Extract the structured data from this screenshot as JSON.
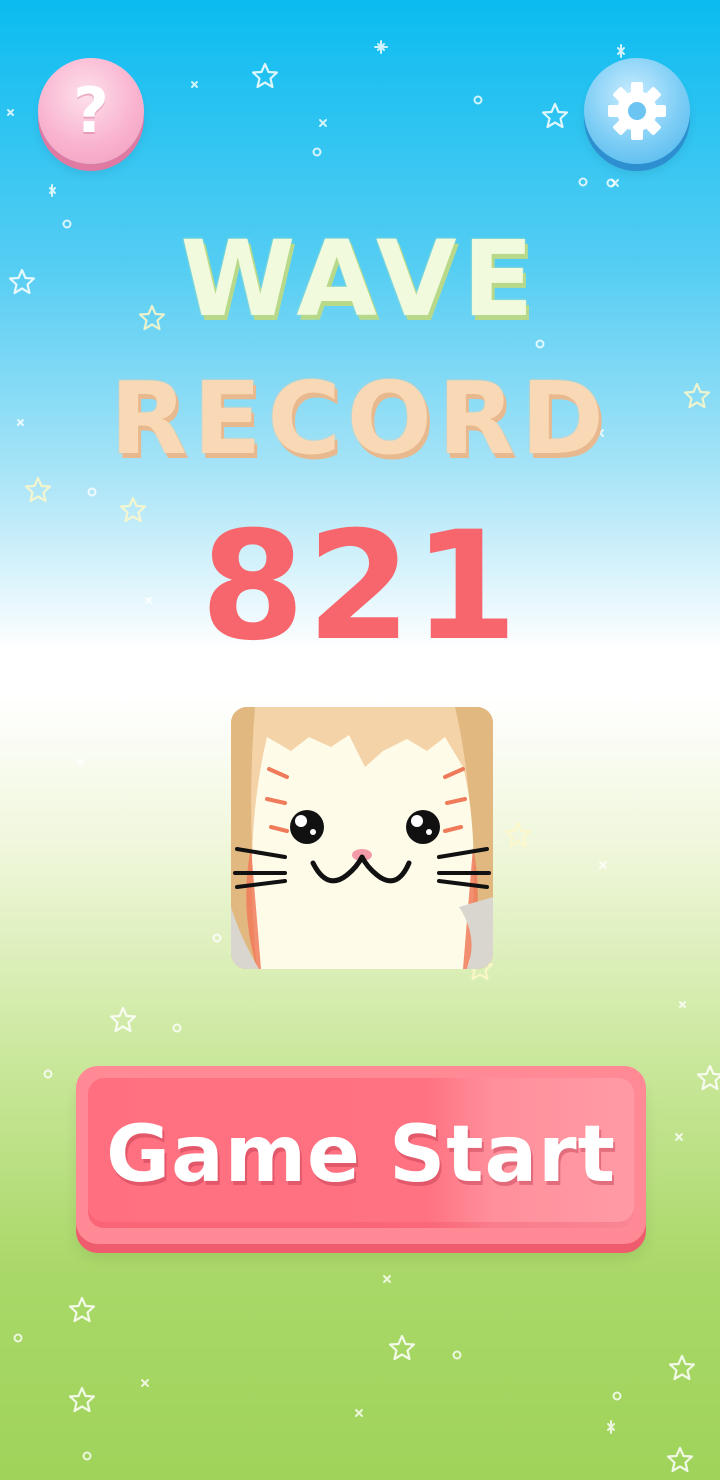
{
  "header": {
    "help_button": {
      "glyph": "?",
      "icon": "question-mark-icon"
    },
    "settings_button": {
      "icon": "gear-icon"
    }
  },
  "title": {
    "line1": "WAVE",
    "line2": "RECORD"
  },
  "record": {
    "score": "821"
  },
  "character": {
    "name": "cat-face",
    "colors": {
      "fur": "#fffbe9",
      "accent": "#f0c99a",
      "stripes": "#f07b5a"
    }
  },
  "start_button": {
    "label": "Game Start"
  },
  "colors": {
    "sky_top": "#0bbcf0",
    "grass_bottom": "#9fd35a",
    "score": "#f7666c",
    "start_button": "#ff7282",
    "help_button": "#f9b4cf",
    "settings_button": "#7ccdf5"
  }
}
